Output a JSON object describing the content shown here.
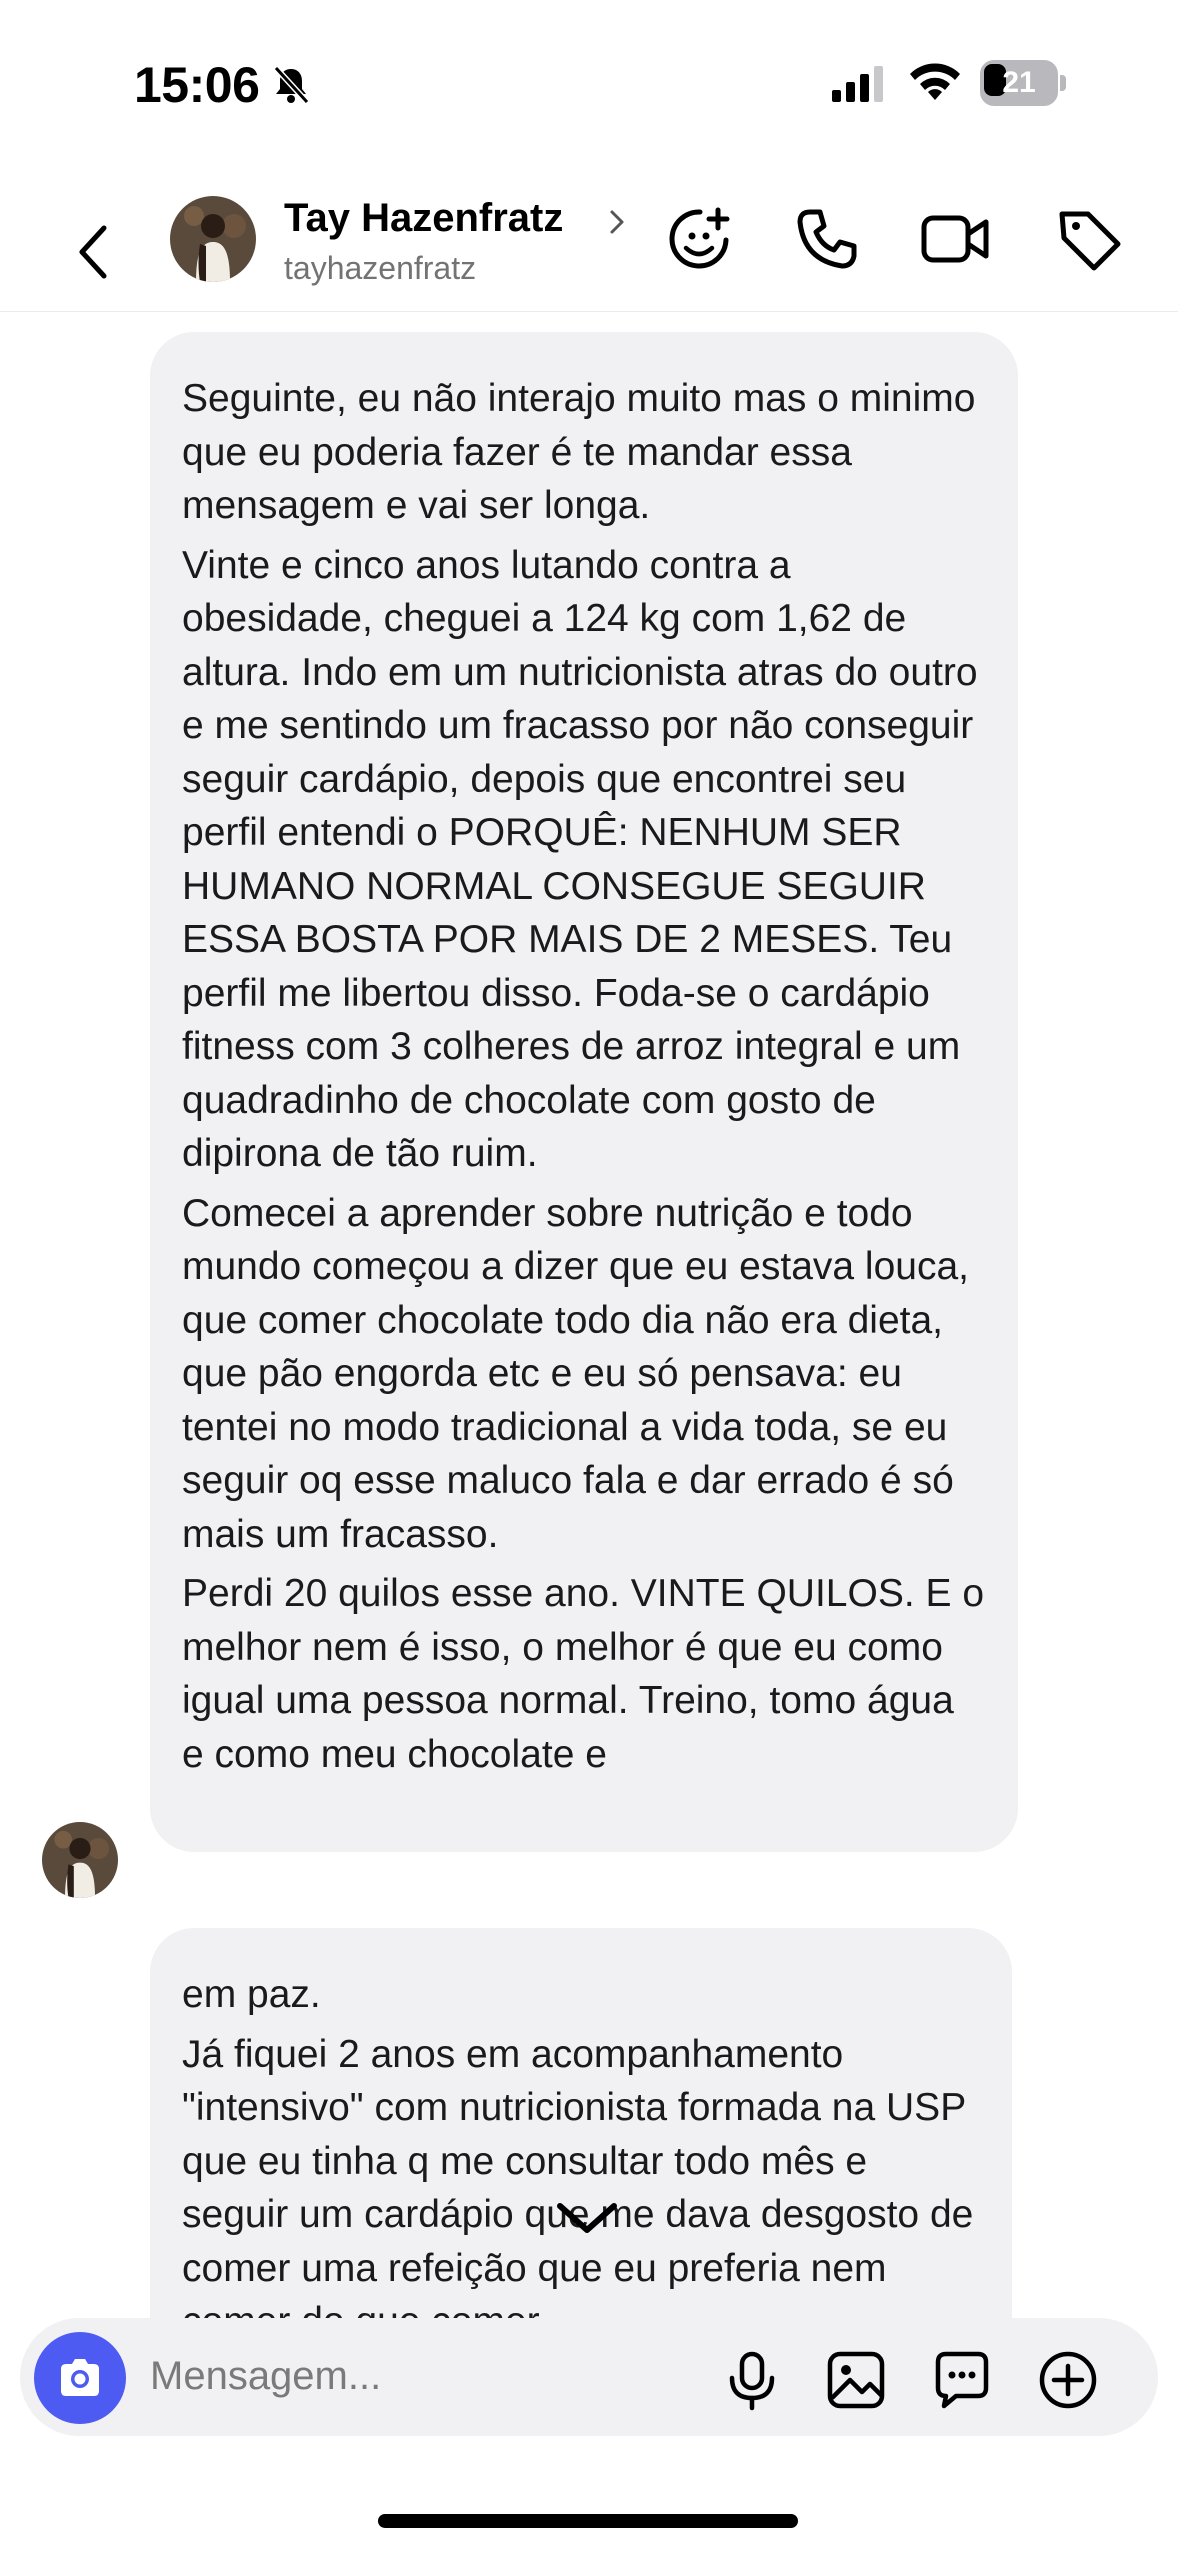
{
  "status_bar": {
    "time": "15:06",
    "battery": "21",
    "icons": [
      "bell-slash-icon",
      "cellular-signal-icon",
      "wifi-icon",
      "battery-icon"
    ]
  },
  "header": {
    "name": "Tay Hazenfratz",
    "handle": "tayhazenfratz",
    "icons": [
      "back-arrow-icon",
      "chevron-right-icon",
      "add-sticker-icon",
      "phone-icon",
      "video-camera-icon",
      "tag-icon"
    ]
  },
  "messages": [
    {
      "paragraphs": [
        "Seguinte, eu não interajo muito mas o minimo que eu poderia fazer é te mandar essa mensagem e vai ser longa.",
        "Vinte e cinco anos lutando contra a obesidade, cheguei a 124 kg com 1,62 de altura. Indo em um nutricionista atras do outro e me sentindo um fracasso por não conseguir seguir cardápio, depois que encontrei seu perfil entendi o PORQUÊ: NENHUM SER HUMANO NORMAL CONSEGUE SEGUIR ESSA BOSTA POR MAIS DE 2 MESES. Teu perfil me libertou disso. Foda-se o cardápio fitness com 3 colheres de arroz integral e um quadradinho de chocolate com gosto de dipirona de tão ruim.",
        "Comecei a aprender sobre nutrição e todo mundo começou a dizer que eu estava louca, que comer chocolate todo dia não era dieta, que pão engorda etc e eu só pensava: eu tentei no modo tradicional a vida toda, se eu seguir oq esse maluco fala e dar errado é só mais um fracasso.",
        "Perdi 20 quilos esse ano. VINTE QUILOS. E o melhor nem é isso, o melhor é que eu como igual uma pessoa normal. Treino, tomo água e como meu chocolate e"
      ]
    },
    {
      "paragraphs": [
        "em paz.",
        "Já fiquei 2 anos em acompanhamento \"intensivo\" com nutricionista formada na USP que eu tinha q me consultar todo mês e seguir um cardápio que me dava desgosto de comer uma refeição que eu preferia nem comer do que comer"
      ]
    }
  ],
  "composer": {
    "placeholder": "Mensagem...",
    "icons": [
      "camera-icon",
      "microphone-icon",
      "image-icon",
      "sticker-chat-icon",
      "plus-circle-icon"
    ]
  },
  "colors": {
    "bubble_bg": "#f1f1f3",
    "camera_button": "#4e5bf2",
    "secondary_text": "#737373"
  }
}
